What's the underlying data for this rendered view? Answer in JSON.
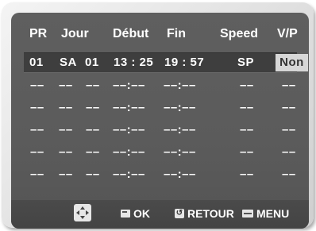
{
  "header": {
    "pr": "PR",
    "jour": "Jour",
    "debut": "Début",
    "fin": "Fin",
    "speed": "Speed",
    "vp": "V/P"
  },
  "rows": [
    {
      "pr": "01",
      "day": "SA",
      "date": "01",
      "start": "13 : 25",
      "end": "19 : 57",
      "speed": "SP",
      "vp": "Non"
    },
    {
      "pr": "–– ",
      "day": "––",
      "date": "––",
      "start": "––:––",
      "end": "––:––",
      "speed": "––",
      "vp": "––"
    },
    {
      "pr": "––",
      "day": "––",
      "date": "––",
      "start": "––:––",
      "end": "––:––",
      "speed": "––",
      "vp": "––"
    },
    {
      "pr": "––",
      "day": "––",
      "date": "––",
      "start": "––:––",
      "end": "––:––",
      "speed": "––",
      "vp": "––"
    },
    {
      "pr": "––",
      "day": "––",
      "date": "––",
      "start": "––:––",
      "end": "––:––",
      "speed": "––",
      "vp": "––"
    },
    {
      "pr": "––",
      "day": "––",
      "date": "––",
      "start": "––:––",
      "end": "––:––",
      "speed": "––",
      "vp": "––"
    }
  ],
  "footer": {
    "ok_label": "OK",
    "return_label": "RETOUR",
    "menu_label": "MENU",
    "dpad_icon": "dpad-icon",
    "ok_icon": "ok-icon",
    "return_icon": "return-icon",
    "menu_icon": "menu-icon"
  }
}
